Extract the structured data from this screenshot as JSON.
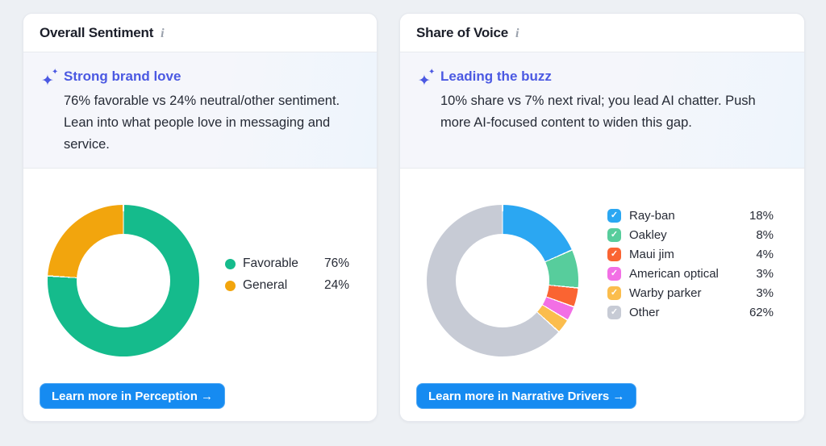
{
  "page": {
    "background_color": "#EDF0F4"
  },
  "colors": {
    "accent_indigo": "#4B59E2",
    "button_blue": "#168BF1",
    "title_text": "#1C1F2A",
    "body_text": "#262B36",
    "info_icon_gray": "#9AA1AC",
    "card_border": "#E5E8EE"
  },
  "cards": [
    {
      "title": "Overall Sentiment",
      "info_icon": "i",
      "sparkle_icon": "✦",
      "insight": {
        "headline": "Strong brand love",
        "body": "76% favorable vs 24% neutral/other sentiment. Lean into what people love in messaging and service."
      },
      "button_label": "Learn more in Perception →"
    },
    {
      "title": "Share of Voice",
      "info_icon": "i",
      "sparkle_icon": "✦",
      "insight": {
        "headline": "Leading the buzz",
        "body": "10% share vs 7% next rival; you lead AI chatter. Push more AI-focused content to widen this gap."
      },
      "button_label": "Learn more in Narrative Drivers →"
    }
  ],
  "chart_data": [
    {
      "type": "pie",
      "subtype": "donut",
      "title": "Overall Sentiment",
      "legend_style": "dot",
      "legend_position": "right",
      "start_angle_deg": 0,
      "direction": "clockwise",
      "series": [
        {
          "label": "Favorable",
          "value": 76,
          "unit": "%",
          "color": "#15BB8C"
        },
        {
          "label": "General",
          "value": 24,
          "unit": "%",
          "color": "#F2A50D"
        }
      ]
    },
    {
      "type": "pie",
      "subtype": "donut",
      "title": "Share of Voice",
      "legend_style": "checkbox",
      "legend_position": "right",
      "start_angle_deg": 0,
      "direction": "clockwise",
      "checkmark": "✓",
      "series": [
        {
          "label": "Ray-ban",
          "value": 18,
          "unit": "%",
          "color": "#2BA7F2",
          "checked": true
        },
        {
          "label": "Oakley",
          "value": 8,
          "unit": "%",
          "color": "#57CD9C",
          "checked": true
        },
        {
          "label": "Maui jim",
          "value": 4,
          "unit": "%",
          "color": "#FA6432",
          "checked": true
        },
        {
          "label": "American optical",
          "value": 3,
          "unit": "%",
          "color": "#F26FE5",
          "checked": true
        },
        {
          "label": "Warby parker",
          "value": 3,
          "unit": "%",
          "color": "#FBBD4D",
          "checked": true
        },
        {
          "label": "Other",
          "value": 62,
          "unit": "%",
          "color": "#C7CBD5",
          "checked": true
        }
      ]
    }
  ]
}
